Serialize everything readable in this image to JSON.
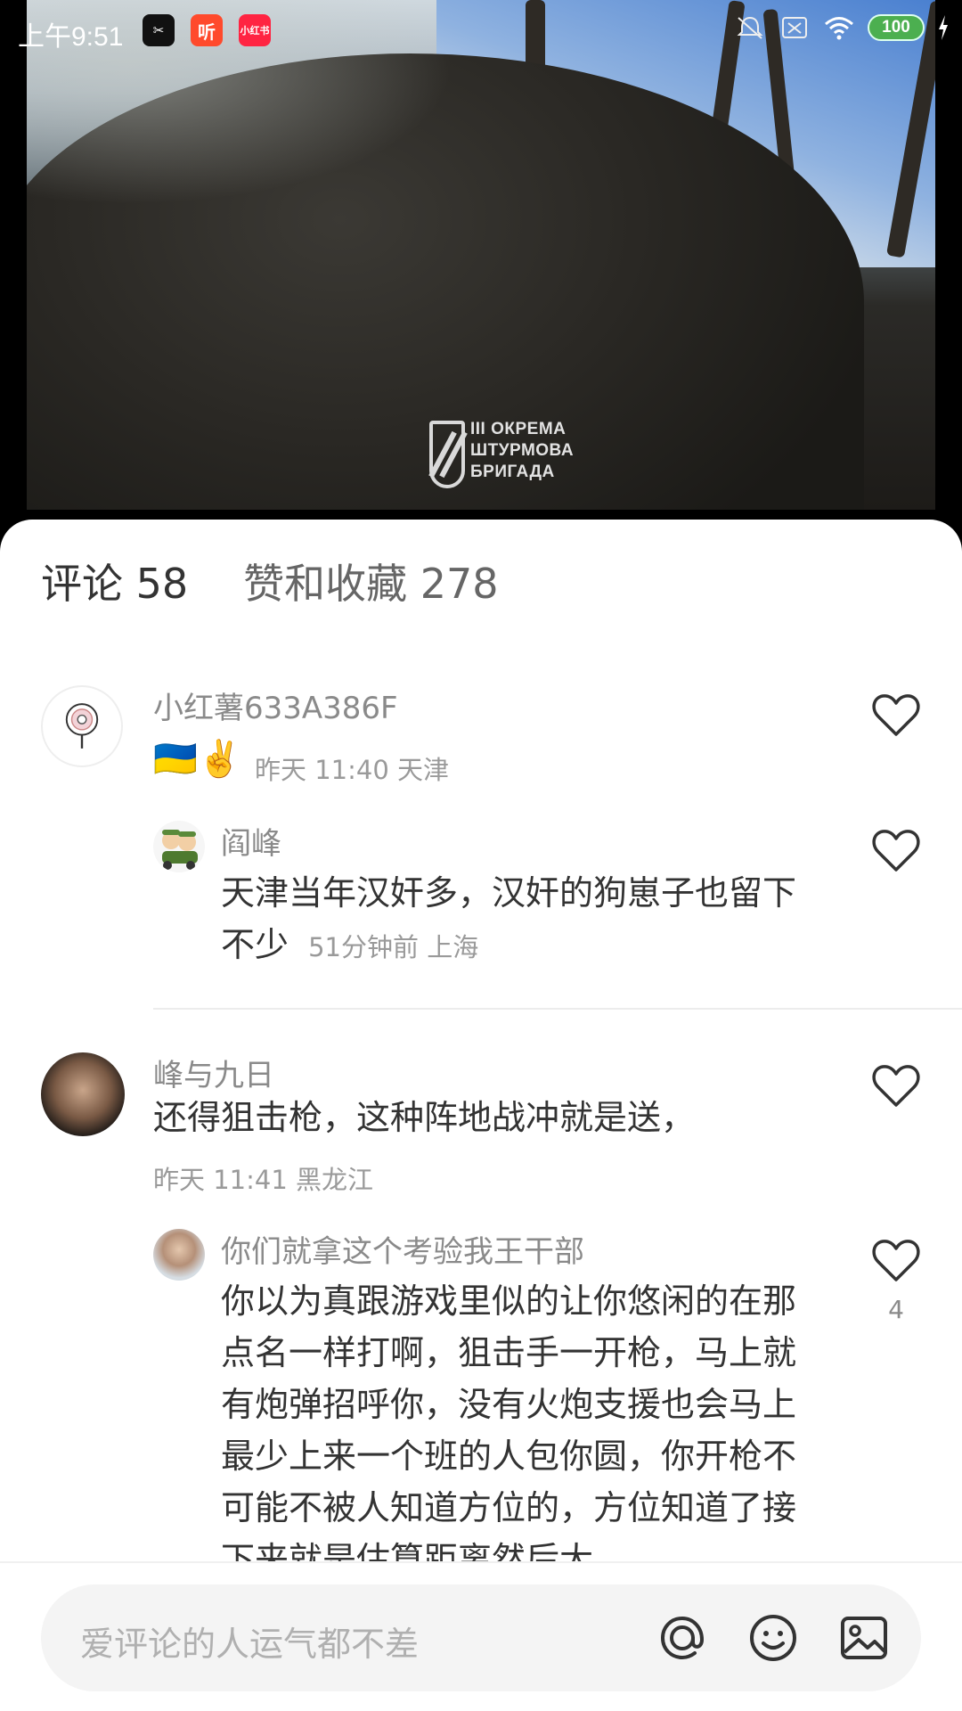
{
  "statusbar": {
    "time": "上午9:51",
    "apps": [
      {
        "name": "capcut-icon",
        "label": "✂",
        "color": "#111111"
      },
      {
        "name": "listen-app-icon",
        "label": "听",
        "color": "#ff4a2c"
      },
      {
        "name": "xiaohongshu-icon",
        "label": "小红书",
        "color": "#ff2442"
      }
    ],
    "battery": "100"
  },
  "video": {
    "watermark_lines": [
      "III ОКРЕМА",
      "ШТУРМОВА",
      "БРИГАДА"
    ]
  },
  "tabs": [
    {
      "label": "评论 58",
      "active": true
    },
    {
      "label": "赞和收藏 278",
      "active": false
    }
  ],
  "comments": [
    {
      "username": "小红薯633A386F",
      "text": "🇺🇦✌️",
      "meta": "昨天 11:40 天津",
      "replies": [
        {
          "username": "阎峰",
          "text": "天津当年汉奸多，汉奸的狗崽子也留下不少",
          "meta": "51分钟前  上海"
        }
      ]
    },
    {
      "username": "峰与九日",
      "text": "还得狙击枪，这种阵地战冲就是送，",
      "meta": "昨天 11:41 黑龙江",
      "replies": [
        {
          "username": "你们就拿这个考验我王干部",
          "text": "你以为真跟游戏里似的让你悠闲的在那点名一样打啊，狙击手一开枪，马上就有炮弹招呼你，没有火炮支援也会马上最少上来一个班的人包你圆，你开枪不可能不被人知道方位的，方位知道了接下来就是估算距离然后大",
          "like_count": "4"
        }
      ]
    }
  ],
  "input": {
    "placeholder": "爱评论的人运气都不差"
  },
  "colors": {
    "text_primary": "#333333",
    "text_secondary": "#8a8a8a",
    "sheet_bg": "#ffffff",
    "input_bg": "#f4f4f4"
  }
}
